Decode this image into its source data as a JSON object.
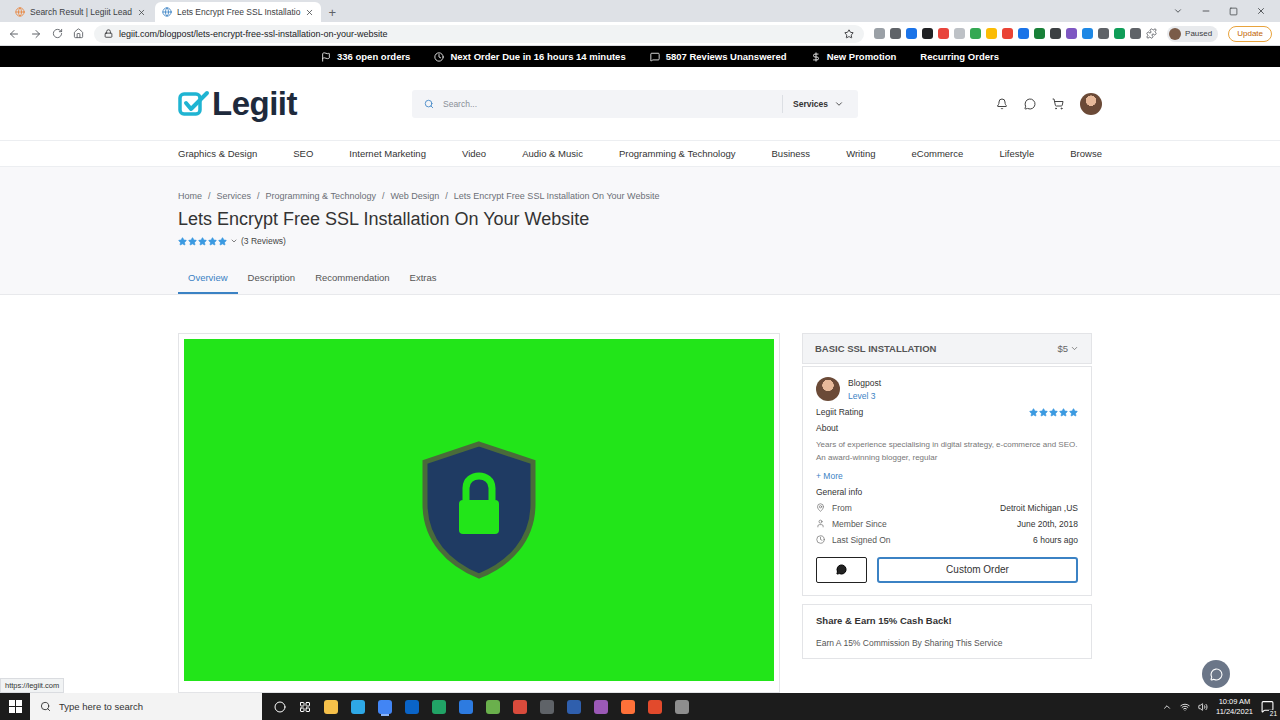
{
  "browser": {
    "tabs": [
      {
        "label": "Search Result | Legiit Lead",
        "selected": false
      },
      {
        "label": "Lets Encrypt Free SSL Installatio",
        "selected": true
      }
    ],
    "new_tab": "+",
    "url": "legiit.com/blogpost/lets-encrypt-free-ssl-installation-on-your-website",
    "profile": "Paused",
    "update": "Update",
    "status_url": "https://legiit.com"
  },
  "top_bar": [
    {
      "label": "336 open orders",
      "kind": "flag"
    },
    {
      "label": "Next Order Due in 16 hours 14 minutes",
      "kind": "clock"
    },
    {
      "label": "5807 Reviews Unanswered",
      "kind": "comment"
    },
    {
      "label": "New Promotion",
      "kind": "dollar"
    },
    {
      "label": "Recurring Orders",
      "kind": "plain"
    }
  ],
  "header": {
    "logo": "Legiit",
    "search_placeholder": "Search...",
    "services": "Services"
  },
  "categories": [
    "Graphics & Design",
    "SEO",
    "Internet Marketing",
    "Video",
    "Audio & Music",
    "Programming & Technology",
    "Business",
    "Writing",
    "eCommerce",
    "Lifestyle",
    "Browse"
  ],
  "breadcrumb": [
    "Home",
    "Services",
    "Programming & Technology",
    "Web Design",
    "Lets Encrypt Free SSL Installation On Your Website"
  ],
  "breadcrumb_separator": "/",
  "title": "Lets Encrypt Free SSL Installation On Your Website",
  "rating": {
    "stars": 5,
    "reviews": "(3 Reviews)"
  },
  "tabs": [
    {
      "label": "Overview",
      "selected": true
    },
    {
      "label": "Description",
      "selected": false
    },
    {
      "label": "Recommendation",
      "selected": false
    },
    {
      "label": "Extras",
      "selected": false
    }
  ],
  "package": {
    "name": "BASIC SSL INSTALLATION",
    "price": "$5"
  },
  "seller": {
    "name": "Blogpost",
    "level": "Level 3",
    "rating_label": "Legiit Rating",
    "stars": 5,
    "about_label": "About",
    "about": "Years of experience specialising in digital strategy, e-commerce and SEO. An award-winning blogger, regular",
    "more": "+ More",
    "general_label": "General info",
    "info": [
      {
        "label": "From",
        "value": "Detroit Michigan ,US",
        "kind": "pin"
      },
      {
        "label": "Member Since",
        "value": "June 20th, 2018",
        "kind": "user"
      },
      {
        "label": "Last Signed On",
        "value": "6 hours ago",
        "kind": "clock"
      }
    ],
    "custom_order": "Custom Order"
  },
  "share": {
    "title": "Share & Earn 15% Cash Back!",
    "text": "Earn A 15% Commission By Sharing This Service"
  },
  "taskbar": {
    "search_placeholder": "Type here to search",
    "time": "10:09 AM",
    "date": "11/24/2021",
    "notifications": "21"
  }
}
